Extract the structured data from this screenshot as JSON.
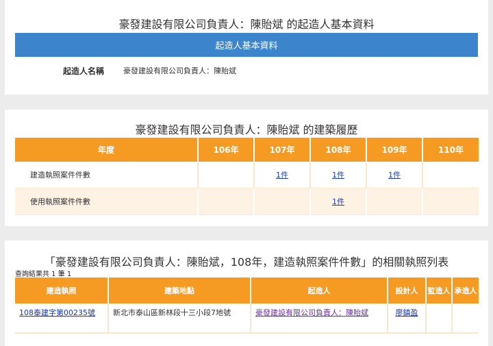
{
  "card1": {
    "title": "豪發建設有限公司負責人：陳貽斌 的起造人基本資料",
    "header": "起造人基本資料",
    "label": "起造人名稱",
    "value": "豪發建設有限公司負責人：陳貽斌"
  },
  "card2": {
    "title": "豪發建設有限公司負責人：陳貽斌 的建築履歷",
    "columns": [
      "年度",
      "106年",
      "107年",
      "108年",
      "109年",
      "110年"
    ],
    "rows": [
      {
        "label": "建造執照案件件數",
        "cells": [
          "",
          "1件",
          "1件",
          "1件",
          ""
        ]
      },
      {
        "label": "使用執照案件件數",
        "cells": [
          "",
          "",
          "1件",
          "",
          ""
        ]
      }
    ]
  },
  "card3": {
    "title": "「豪發建設有限公司負責人：陳貽斌，108年，建造執照案件件數」的相關執照列表",
    "result_count": "查詢結果共 1 筆  1",
    "columns": [
      "建造執照",
      "建築地點",
      "起造人",
      "設計人",
      "監造人",
      "承造人"
    ],
    "rows": [
      {
        "license": "108泰建字第00235號",
        "location": "新北市泰山區新林段十三小段7地號",
        "builder": "豪發建設有限公司負責人：陳貽斌",
        "designer": "廖鎮盈",
        "supervisor": "",
        "contractor": ""
      }
    ]
  },
  "colors": {
    "blue_header": "#3c85cc",
    "orange_header": "#f59b23",
    "alt_row": "#fdf2e4",
    "link": "#1a3aa6",
    "visited_link": "#6b2fa0"
  }
}
